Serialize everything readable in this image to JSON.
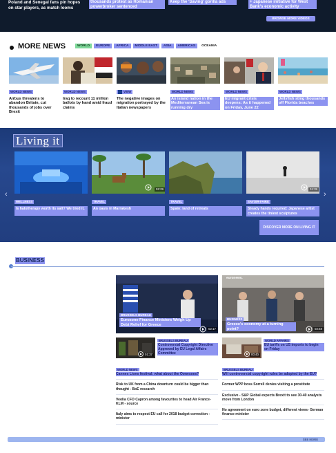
{
  "top_strip": {
    "col1": "Poland and Senegal fans pin hopes on star players, as match looms",
    "col2": "thousands protest as Romanian powerbroker sentenced",
    "col3": "Keep the 'Saving' gorilla ads",
    "col4": "+ Japanese initiative for West Bank's economic activity",
    "browse_label": "BROWSE MORE VIDEOS"
  },
  "more_news": {
    "title": "MORE NEWS",
    "tabs": [
      "WORLD",
      "EUROPE",
      "AFRICA",
      "MIDDLE EAST",
      "ASIA",
      "AMERICAS",
      "OCEANIA"
    ],
    "items": [
      {
        "category": "WORLD NEWS",
        "headline": "Airbus threatens to abandon Britain, cut thousands of jobs over Brexit"
      },
      {
        "category": "WORLD NEWS",
        "headline": "Iraq to recount 11 million ballots by hand amid fraud claims"
      },
      {
        "category": "VIEW",
        "headline": "The negative images on migration portrayed by the Italian newspapers"
      },
      {
        "category": "WORLD NEWS",
        "headline": "An island nation in the Mediterranean Sea is running dry"
      },
      {
        "category": "WORLD NEWS",
        "headline": "EU migrant crisis deepens: As it happened on Friday, June 22"
      },
      {
        "category": "WORLD NEWS",
        "headline": "Jellyfish sting thousands off Florida beaches"
      }
    ]
  },
  "living": {
    "logo": "Living it",
    "items": [
      {
        "category": "WELLNESS",
        "headline": "Is halotherapy worth its salt? We tried it.",
        "duration": ""
      },
      {
        "category": "TRAVEL",
        "headline": "An oasis in Marrakesh",
        "duration": "02:29"
      },
      {
        "category": "TRAVEL",
        "headline": "Spain: land of retreats",
        "duration": ""
      },
      {
        "category": "SAVOIR-FAIRE",
        "headline": "Steady hands required: Japanese artist creates the tiniest sculptures",
        "duration": "01:39"
      }
    ],
    "discover_label": "DISCOVER MORE ON LIVING IT"
  },
  "business": {
    "title": "BUSINESS",
    "featured": [
      {
        "category": "BRUSSELS BUREAU",
        "headline": "Eurozone Finance Ministers Weigh Up Debt Relief for Greece",
        "duration": "02:17"
      },
      {
        "category": "BUSINESS",
        "headline": "Greece's economy at a turning point?",
        "duration": "02:48",
        "logo": "euronews."
      }
    ],
    "small": [
      {
        "category": "BRUSSELS BUREAU",
        "headline": "Controversial Copyright Directive Approved by EU Legal Affairs Committee",
        "duration": "01:37"
      },
      {
        "category": "WORLD AFFAIRS",
        "headline": "EU tariffs on US imports to begin on Friday",
        "duration": "00:40"
      }
    ],
    "list_left": [
      {
        "category": "WORLD NEWS",
        "headline": "Cannes Lions festival: what about the Oonesses?"
      },
      {
        "category": "",
        "headline": "Risk to UK from a China downturn could be bigger than thought - BoE research"
      },
      {
        "category": "",
        "headline": "Veolia CFO Capron among favourites to head Air France-KLM - source"
      },
      {
        "category": "",
        "headline": "Italy aims to respect EU call for 2018 budget correction - minister"
      }
    ],
    "list_right": [
      {
        "category": "BRUSSELS BUREAU",
        "headline": "Will controversial copyright rules be adopted by the EU?"
      },
      {
        "category": "",
        "headline": "Former WPP boss Sorrell denies visiting a prostitute"
      },
      {
        "category": "",
        "headline": "Exclusive - S&P Global expects Brexit to see 30-40 analysts move from London"
      },
      {
        "category": "",
        "headline": "No agreement on euro zone budget, different views- German finance minister"
      }
    ],
    "see_more": "SEE MORE"
  },
  "colors": {
    "accent": "#8c93f0",
    "top_bg": "#0f1b2c",
    "living_bg": "#27488e"
  }
}
